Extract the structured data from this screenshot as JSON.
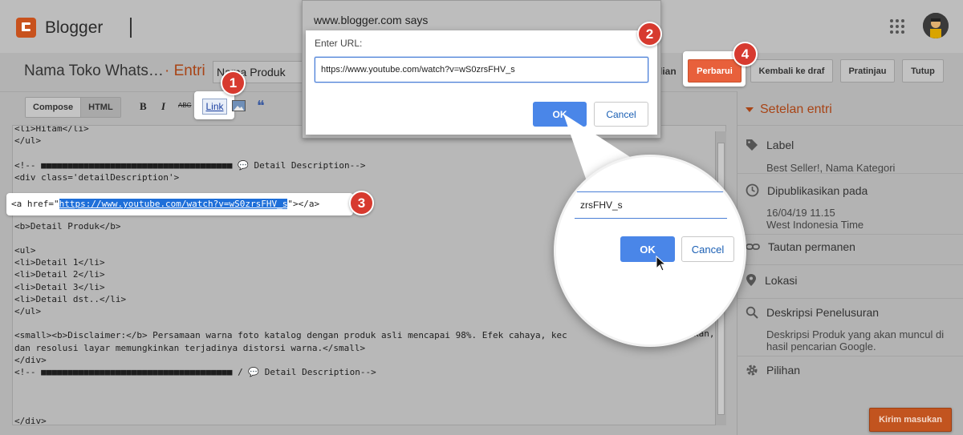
{
  "app": {
    "name": "Blogger"
  },
  "header": {
    "blog_title": "Nama Toko Whats…",
    "section": "· Entri",
    "post_title": "Nama Produk",
    "partial_label": "dian",
    "buttons": {
      "publish": "Perbarui",
      "revert": "Kembali ke draf",
      "preview": "Pratinjau",
      "close": "Tutup"
    }
  },
  "toolbar": {
    "compose": "Compose",
    "html": "HTML",
    "bold": "B",
    "italic": "I",
    "strike": "ABC",
    "link": "Link",
    "quote": "❝"
  },
  "editor": {
    "lines": [
      "<li>Hitam</li>",
      "</ul>",
      "",
      "<!-- ■■■■■■■■■■■■■■■■■■■■■■■■■■■■■■■■■■■■ 💬 Detail Description-->",
      "<div class='detailDescription'>",
      "",
      "",
      "",
      "<b>Detail Produk</b>",
      "",
      "<ul>",
      "<li>Detail 1</li>",
      "<li>Detail 2</li>",
      "<li>Detail 3</li>",
      "<li>Detail dst..</li>",
      "</ul>",
      "",
      "<small><b>Disclaimer:</b> Persamaan warna foto katalog dengan produk asli mencapai 98%. Efek cahaya, kec",
      "dan resolusi layar memungkinkan terjadinya distorsi warna.</small>",
      "</div>",
      "<!-- ■■■■■■■■■■■■■■■■■■■■■■■■■■■■■■■■■■■■ / 💬 Detail Description-->",
      "",
      "",
      "",
      "</div>"
    ],
    "clipped_right": "kan,",
    "anchor_prefix": "<a href=\"",
    "anchor_url": "https://www.youtube.com/watch?v=wS0zrsFHV_s",
    "anchor_suffix": "\"></a>"
  },
  "dialog": {
    "title": "www.blogger.com says",
    "label": "Enter URL:",
    "value": "https://www.youtube.com/watch?v=wS0zrsFHV_s",
    "ok": "OK",
    "cancel": "Cancel"
  },
  "magnifier": {
    "text": "zrsFHV_s",
    "ok": "OK",
    "cancel": "Cancel"
  },
  "callouts": [
    "1",
    "2",
    "3",
    "4"
  ],
  "sidebar": {
    "heading": "Setelan entri",
    "label": {
      "title": "Label",
      "value": "Best Seller!, Nama Kategori"
    },
    "published": {
      "title": "Dipublikasikan pada",
      "date": "16/04/19 11.15",
      "zone": "West Indonesia Time"
    },
    "permalink": "Tautan permanen",
    "location": "Lokasi",
    "search_desc": {
      "title": "Deskripsi Penelusuran",
      "line1": "Deskripsi Produk yang akan muncul di",
      "line2": "hasil pencarian Google."
    },
    "options": "Pilihan"
  },
  "feedback": "Kirim masukan",
  "colors": {
    "accent": "#a84416",
    "publish": "#e8603b",
    "callout": "#d73a2f",
    "ok_button": "#4a86e8",
    "selection": "#1e6fd9"
  }
}
